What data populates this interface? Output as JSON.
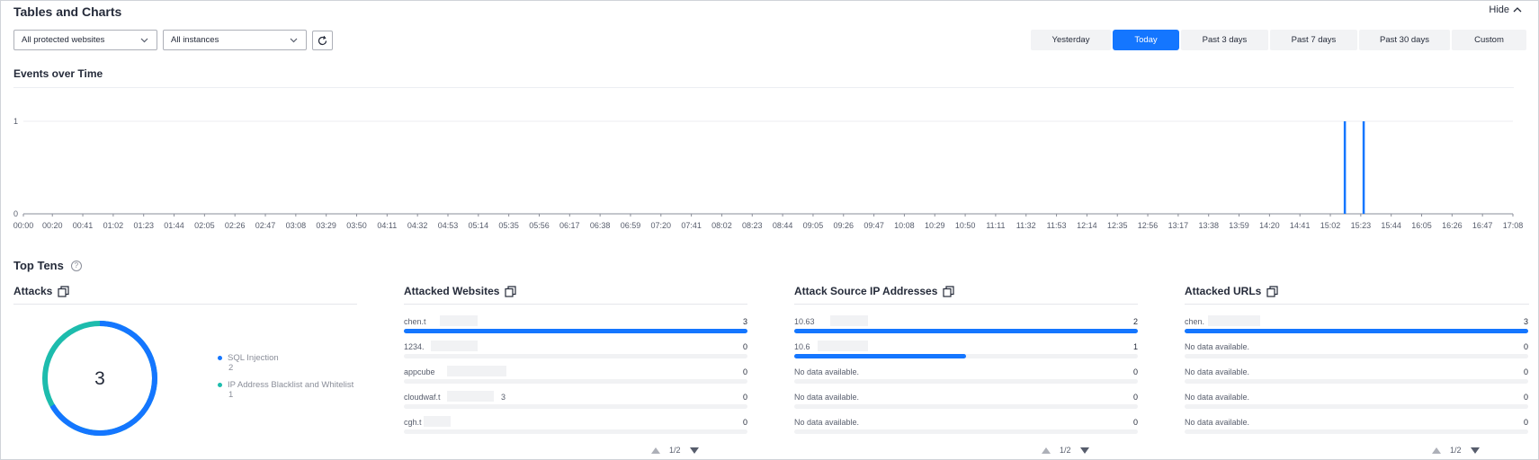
{
  "header": {
    "title": "Tables and Charts",
    "hide_label": "Hide"
  },
  "filters": {
    "website": "All protected websites",
    "instance": "All instances"
  },
  "time_ranges": [
    {
      "label": "Yesterday",
      "active": false
    },
    {
      "label": "Today",
      "active": true
    },
    {
      "label": "Past 3 days",
      "active": false
    },
    {
      "label": "Past 7 days",
      "active": false
    },
    {
      "label": "Past 30 days",
      "active": false
    },
    {
      "label": "Custom",
      "active": false
    }
  ],
  "events_chart_title": "Events over Time",
  "chart_data": {
    "type": "bar",
    "title": "Events over Time",
    "xlabel": "",
    "ylabel": "",
    "ylim": [
      0,
      1
    ],
    "y_ticks": [
      "0",
      "1"
    ],
    "x_ticks": [
      "00:00",
      "00:20",
      "00:41",
      "01:02",
      "01:23",
      "01:44",
      "02:05",
      "02:26",
      "02:47",
      "03:08",
      "03:29",
      "03:50",
      "04:11",
      "04:32",
      "04:53",
      "05:14",
      "05:35",
      "05:56",
      "06:17",
      "06:38",
      "06:59",
      "07:20",
      "07:41",
      "08:02",
      "08:23",
      "08:44",
      "09:05",
      "09:26",
      "09:47",
      "10:08",
      "10:29",
      "10:50",
      "11:11",
      "11:32",
      "11:53",
      "12:14",
      "12:35",
      "12:56",
      "13:17",
      "13:38",
      "13:59",
      "14:20",
      "14:41",
      "15:02",
      "15:23",
      "15:44",
      "16:05",
      "16:26",
      "16:47",
      "17:08"
    ],
    "events": [
      {
        "x": "15:12",
        "y": 1
      },
      {
        "x": "15:25",
        "y": 1
      }
    ],
    "color": "#1476ff"
  },
  "top_tens": {
    "title": "Top Tens",
    "attacks": {
      "title": "Attacks",
      "total": "3",
      "items": [
        {
          "label": "SQL Injection",
          "count": "2",
          "color": "#1476ff"
        },
        {
          "label": "IP Address Blacklist and Whitelist",
          "count": "1",
          "color": "#1dbcad"
        }
      ]
    },
    "panels": [
      {
        "title": "Attacked Websites",
        "pager": "1/2",
        "rows": [
          {
            "label": "chen.t",
            "value": "3",
            "fraction": 1.0
          },
          {
            "label": "1234.",
            "value": "0",
            "fraction": 0
          },
          {
            "label": "appcube",
            "value": "0",
            "fraction": 0
          },
          {
            "label": "cloudwaf.t",
            "suffix": "3",
            "value": "0",
            "fraction": 0
          },
          {
            "label": "cgh.t",
            "value": "0",
            "fraction": 0
          }
        ]
      },
      {
        "title": "Attack Source IP Addresses",
        "pager": "1/2",
        "rows": [
          {
            "label": "10.63",
            "value": "2",
            "fraction": 1.0
          },
          {
            "label": "10.6",
            "value": "1",
            "fraction": 0.5
          },
          {
            "label": "No data available.",
            "value": "0",
            "fraction": 0
          },
          {
            "label": "No data available.",
            "value": "0",
            "fraction": 0
          },
          {
            "label": "No data available.",
            "value": "0",
            "fraction": 0
          }
        ]
      },
      {
        "title": "Attacked URLs",
        "pager": "1/2",
        "rows": [
          {
            "label": "chen.",
            "value": "3",
            "fraction": 1.0
          },
          {
            "label": "No data available.",
            "value": "0",
            "fraction": 0
          },
          {
            "label": "No data available.",
            "value": "0",
            "fraction": 0
          },
          {
            "label": "No data available.",
            "value": "0",
            "fraction": 0
          },
          {
            "label": "No data available.",
            "value": "0",
            "fraction": 0
          }
        ]
      }
    ]
  }
}
